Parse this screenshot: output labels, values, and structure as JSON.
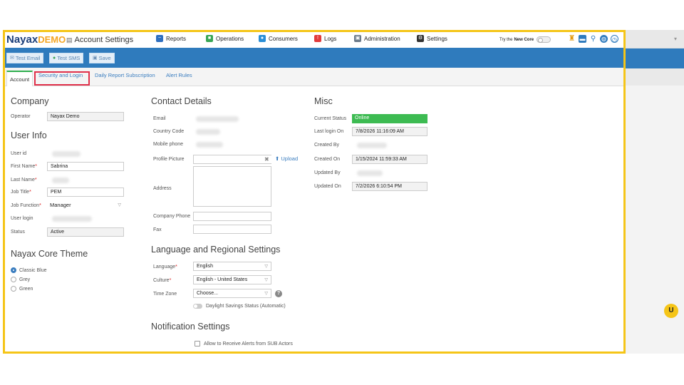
{
  "app": {
    "logo": "Nayax",
    "logo_suffix": "DEMO",
    "page_title": "Account Settings"
  },
  "nav": [
    {
      "label": "Reports",
      "color": "#2f6fbf"
    },
    {
      "label": "Operations",
      "color": "#3aa655"
    },
    {
      "label": "Consumers",
      "color": "#2a8ed6"
    },
    {
      "label": "Logs",
      "color": "#e23b3b"
    },
    {
      "label": "Administration",
      "color": "#6b7a8a"
    },
    {
      "label": "Settings",
      "color": "#333333"
    }
  ],
  "try_core": {
    "prefix": "Try the",
    "bold": "New Core"
  },
  "toolbar": {
    "test_email": "Test Email",
    "test_sms": "Test SMS",
    "save": "Save"
  },
  "tabs": [
    "Account",
    "Security and Login",
    "Daily Report Subscription",
    "Alert Rules"
  ],
  "company": {
    "title": "Company",
    "operator_label": "Operator",
    "operator_value": "Nayax Demo"
  },
  "user_info": {
    "title": "User Info",
    "user_id_label": "User id",
    "first_name_label": "First Name",
    "first_name_value": "Sabrina",
    "last_name_label": "Last Name",
    "job_title_label": "Job Title",
    "job_title_value": "PEM",
    "job_function_label": "Job Function",
    "job_function_value": "Manager",
    "user_login_label": "User login",
    "status_label": "Status",
    "status_value": "Active"
  },
  "theme": {
    "title": "Nayax Core Theme",
    "options": [
      "Classic Blue",
      "Grey",
      "Green"
    ],
    "selected": "Classic Blue"
  },
  "contact": {
    "title": "Contact Details",
    "email_label": "Email",
    "country_label": "Country Code",
    "mobile_label": "Mobile phone",
    "picture_label": "Profile Picture",
    "upload_label": "Upload",
    "address_label": "Address",
    "company_phone_label": "Company Phone",
    "fax_label": "Fax"
  },
  "language": {
    "title": "Language and Regional Settings",
    "language_label": "Language",
    "language_value": "English",
    "culture_label": "Culture",
    "culture_value": "English - United States",
    "timezone_label": "Time Zone",
    "timezone_value": "Choose...",
    "daylight_label": "Daylight Savings Status (Automatic)"
  },
  "notification": {
    "title": "Notification Settings",
    "sub_actors_label": "Allow to Receive Alerts from SUB Actors"
  },
  "misc": {
    "title": "Misc",
    "current_status_label": "Current Status",
    "current_status_value": "Online",
    "last_login_label": "Last login On",
    "last_login_value": "7/8/2026 11:16:09 AM",
    "created_by_label": "Created By",
    "created_on_label": "Created On",
    "created_on_value": "1/15/2024 11:59:33 AM",
    "updated_by_label": "Updated By",
    "updated_on_label": "Updated On",
    "updated_on_value": "7/2/2026 6:10:54 PM"
  },
  "colors": {
    "highlight_frame": "#f5c518",
    "toolbar_blue": "#2f7bbd",
    "online_green": "#3dbb52",
    "tab_highlight": "#e0304a"
  }
}
